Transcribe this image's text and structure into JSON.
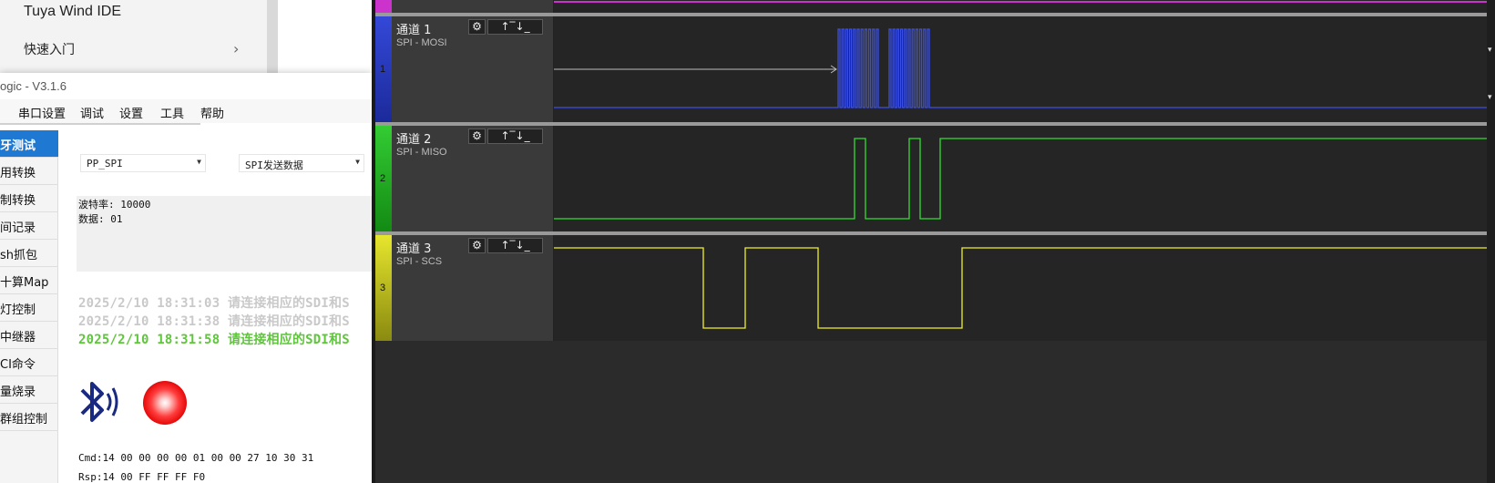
{
  "ide": {
    "title": "Tuya Wind IDE",
    "quick_start": "快速入门",
    "chevron_icon": "chevron-right-icon"
  },
  "tool": {
    "title": "ogic - V3.1.6",
    "menu": [
      "串口设置",
      "调试",
      "设置",
      "工具",
      "帮助"
    ],
    "sidebar": [
      "牙测试",
      "用转换",
      "制转换",
      "间记录",
      "sh抓包",
      "十算Map",
      "灯控制",
      "中继器",
      "CI命令",
      "量烧录",
      "群组控制"
    ],
    "active_index": 0,
    "mode_select": "PP_SPI",
    "action_select": "SPI发送数据",
    "info_lines": [
      "波特率: 10000",
      "数据: 01"
    ],
    "log": [
      {
        "text": "2025/2/10 18:31:03 请连接相应的SDI和S",
        "color": "#c9c9c9"
      },
      {
        "text": "2025/2/10 18:31:38 请连接相应的SDI和S",
        "color": "#c9c9c9"
      },
      {
        "text": "2025/2/10 18:31:58 请连接相应的SDI和S",
        "color": "#5ec63a"
      }
    ],
    "bluetooth_icon": "bluetooth-icon",
    "status_led_color": "#ff0000",
    "cmd": "Cmd:14 00 00 00 00 01 00 00 27 10 30 31",
    "rsp": "Rsp:14 00 FF FF FF F0"
  },
  "analyzer": {
    "channels": [
      {
        "num": "1",
        "name": "通道 1",
        "protocol": "SPI - MOSI",
        "color": "#3448d8",
        "color_dark": "#1b2a9a"
      },
      {
        "num": "2",
        "name": "通道 2",
        "protocol": "SPI - MISO",
        "color": "#33cc33",
        "color_dark": "#138a13"
      },
      {
        "num": "3",
        "name": "通道 3",
        "protocol": "SPI - SCS",
        "color": "#e6e62e",
        "color_dark": "#8a8a10"
      }
    ],
    "button_icons": [
      "gear-icon",
      "trigger-rising-icon",
      "trigger-high-icon",
      "trigger-falling-icon",
      "trigger-low-icon"
    ],
    "button_glyphs": [
      "⚙",
      "↑",
      "‾",
      "↓",
      "_"
    ],
    "top_channel_color": "#cc33cc",
    "scroll_marks": [
      "▾",
      "▾"
    ]
  }
}
